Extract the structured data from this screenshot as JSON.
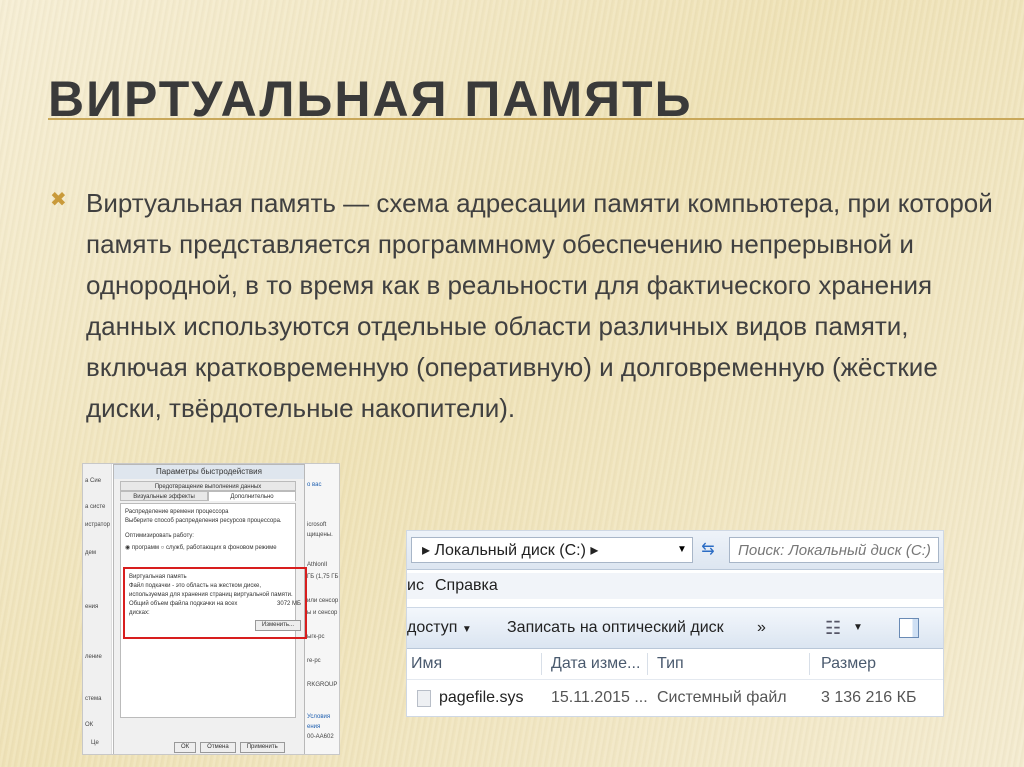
{
  "slide": {
    "title": "Виртуальная память",
    "bullet": "Виртуальная память — схема адресации памяти компьютера, при которой память представляется программному обеспечению непрерывной и однородной, в то время как в реальности для фактического хранения данных используются отдельные области различных видов памяти, включая кратковременную (оперативную) и долговременную (жёсткие диски, твёрдотельные накопители).",
    "bullet_icon": "x-bullet-icon",
    "accent_color": "#c99a3a"
  },
  "dialog": {
    "title": "Параметры быстродействия",
    "tabs_top": [
      "Предотвращение выполнения данных"
    ],
    "tabs": [
      "Визуальные эффекты",
      "Дополнительно"
    ],
    "cpu_heading": "Распределение времени процессора",
    "cpu_desc": "Выберите способ распределения ресурсов процессора.",
    "optimize_label": "Оптимизировать работу:",
    "radio_programs": "программ",
    "radio_services": "служб, работающих в фоновом режиме",
    "vm_heading": "Виртуальная память",
    "vm_desc": "Файл подкачки - это область на жестком диске, используемая для хранения страниц виртуальной памяти.",
    "vm_total_label": "Общий объем файла подкачки на всех дисках:",
    "vm_total_value": "3072 МБ",
    "change_button": "Изменить...",
    "ok_button": "ОК",
    "cancel_button": "Отмена",
    "apply_button": "Применить",
    "left_fragments": [
      "а Сие",
      "а систе",
      "истратор",
      "дем",
      "ения",
      "ление",
      "стема",
      "ОК",
      "Це"
    ],
    "right_fragments": [
      "о вас",
      "icrosoft",
      "щищены.",
      "AthlonII",
      "ГБ (1,75 ГБ",
      "или сенсор",
      "ы и сенсор",
      "ыгк-рс",
      "re-pc",
      "RKGROUP",
      "Условия",
      "ения",
      "00-АА602"
    ]
  },
  "explorer": {
    "address": "Локальный диск (C:)",
    "search_placeholder": "Поиск: Локальный диск (C:)",
    "menu_fragment": "ис",
    "menu_help": "Справка",
    "toolbar_share": "доступ",
    "toolbar_burn": "Записать на оптический диск",
    "toolbar_more": "»",
    "columns": [
      "Имя",
      "Дата изме...",
      "Тип",
      "Размер"
    ],
    "rows": [
      {
        "name": "pagefile.sys",
        "date": "15.11.2015 ...",
        "type": "Системный файл",
        "size": "3 136 216 КБ"
      }
    ]
  }
}
